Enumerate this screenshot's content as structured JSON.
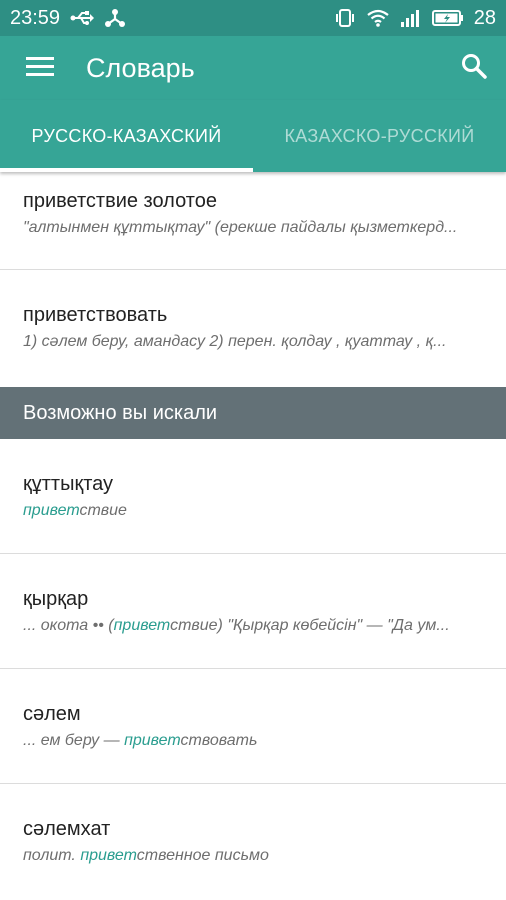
{
  "status_bar": {
    "time": "23:59",
    "battery_percent": "28",
    "icons": [
      "usb-icon",
      "share-icon",
      "vibrate-icon",
      "wifi-icon",
      "signal-icon",
      "battery-icon"
    ]
  },
  "app_bar": {
    "title": "Словарь",
    "menu_icon": "hamburger-menu-icon",
    "search_icon": "search-icon"
  },
  "tabs": [
    {
      "label": "РУССКО-КАЗАХСКИЙ",
      "active": true
    },
    {
      "label": "КАЗАХСКО-РУССКИЙ",
      "active": false
    }
  ],
  "results": [
    {
      "word": "приветствие золотое",
      "definition": "\"алтынмен құттықтау\" (ерекше пайдалы қызметкерд..."
    },
    {
      "word": "приветствовать",
      "definition": "1) сәлем беру, амандасу 2) перен. қолдау , қуаттау , қ..."
    }
  ],
  "suggestions_header": "Возможно вы искали",
  "suggestions": [
    {
      "word": "құттықтау",
      "def_pre": "",
      "def_highlight": "привет",
      "def_post": "ствие"
    },
    {
      "word": "қырқар",
      "def_pre": "... окота •• (",
      "def_highlight": "привет",
      "def_post": "ствие) \"Қырқар көбейсін\" — \"Да ум..."
    },
    {
      "word": "сәлем",
      "def_pre": "... ем беру — ",
      "def_highlight": "привет",
      "def_post": "ствовать"
    },
    {
      "word": "сәлемхат",
      "def_pre": "полит. ",
      "def_highlight": "привет",
      "def_post": "ственное письмо"
    }
  ],
  "colors": {
    "status_bar": "#2e8f84",
    "app_bar": "#36a596",
    "section_header": "#637177",
    "highlight": "#2a9d8f"
  }
}
